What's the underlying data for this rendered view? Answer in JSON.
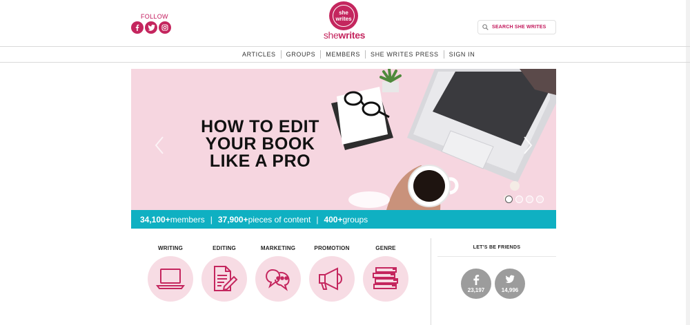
{
  "header": {
    "follow_label": "FOLLOW",
    "social_icons": [
      "facebook-icon",
      "twitter-icon",
      "instagram-icon"
    ],
    "logo": {
      "badge_line1": "she",
      "badge_line2": "writes",
      "word_she": "she",
      "word_writes": "writes"
    },
    "search_placeholder": "SEARCH SHE WRITES"
  },
  "nav": {
    "items": [
      "ARTICLES",
      "GROUPS",
      "MEMBERS",
      "SHE WRITES PRESS",
      "SIGN IN"
    ]
  },
  "hero": {
    "title_line1": "HOW TO EDIT",
    "title_line2": "YOUR BOOK",
    "title_line3": "LIKE A PRO",
    "slide_count": 4,
    "active_slide": 1
  },
  "stats": {
    "members_value": "34,100+",
    "members_label": " members",
    "content_value": "37,900+",
    "content_label": " pieces of content",
    "groups_value": "400+",
    "groups_label": " groups",
    "separator": "|"
  },
  "categories": [
    {
      "label": "WRITING",
      "icon": "laptop-icon"
    },
    {
      "label": "EDITING",
      "icon": "document-edit-icon"
    },
    {
      "label": "MARKETING",
      "icon": "speech-bubbles-icon"
    },
    {
      "label": "PROMOTION",
      "icon": "megaphone-icon"
    },
    {
      "label": "GENRE",
      "icon": "books-stack-icon"
    }
  ],
  "friends": {
    "title": "LET'S BE FRIENDS",
    "facebook_count": "23,197",
    "twitter_count": "14,996"
  },
  "colors": {
    "brand": "#c4265e",
    "stats_bar": "#0fb0c2",
    "hero_bg": "#f6d6e0",
    "category_circle": "#f7dce4",
    "friend_circle": "#9c9c9c"
  }
}
